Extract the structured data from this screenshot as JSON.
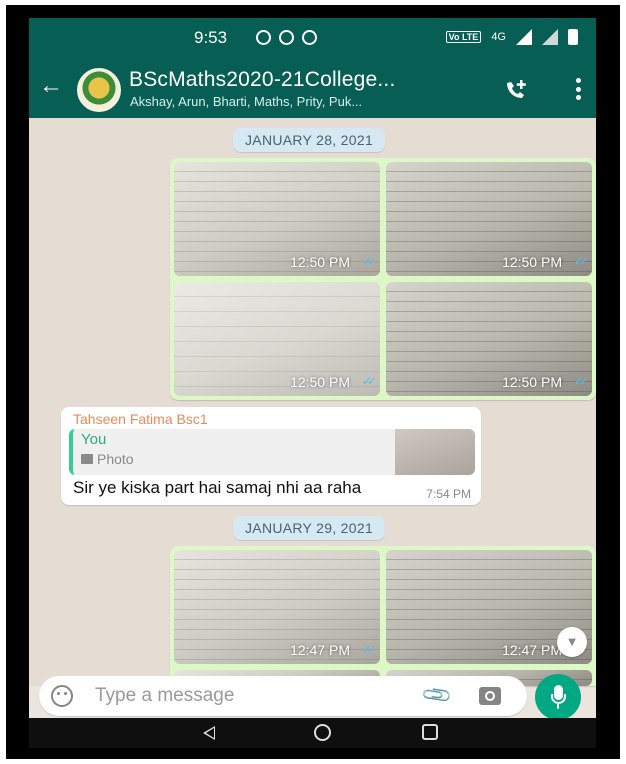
{
  "status_bar": {
    "time": "9:53",
    "network": "4G",
    "volte": "Vo LTE"
  },
  "header": {
    "title": "BScMaths2020-21College...",
    "subtitle": "Akshay, Arun, Bharti, Maths, Prity, Puk...",
    "colors": {
      "primary": "#075e54",
      "accent": "#00a884"
    }
  },
  "chat": {
    "date1": "JANUARY 28, 2021",
    "grid1": [
      {
        "time": "12:50 PM"
      },
      {
        "time": "12:50 PM"
      },
      {
        "time": "12:50 PM"
      },
      {
        "time": "12:50 PM"
      }
    ],
    "reply_message": {
      "sender": "Tahseen Fatima Bsc1",
      "quoted_author": "You",
      "quoted_type": "Photo",
      "text": "Sir ye kiska part hai samaj nhi aa raha",
      "time": "7:54 PM"
    },
    "date2": "JANUARY 29, 2021",
    "grid2": [
      {
        "time": "12:47 PM"
      },
      {
        "time": "12:47 PM"
      }
    ]
  },
  "input": {
    "placeholder": "Type a message"
  },
  "icons": {
    "back": "back-arrow-icon",
    "call": "add-call-icon",
    "menu": "more-vert-icon",
    "emoji": "emoji-icon",
    "attach": "attach-icon",
    "camera": "camera-icon",
    "mic": "mic-icon",
    "scroll": "chevron-double-down-icon"
  }
}
